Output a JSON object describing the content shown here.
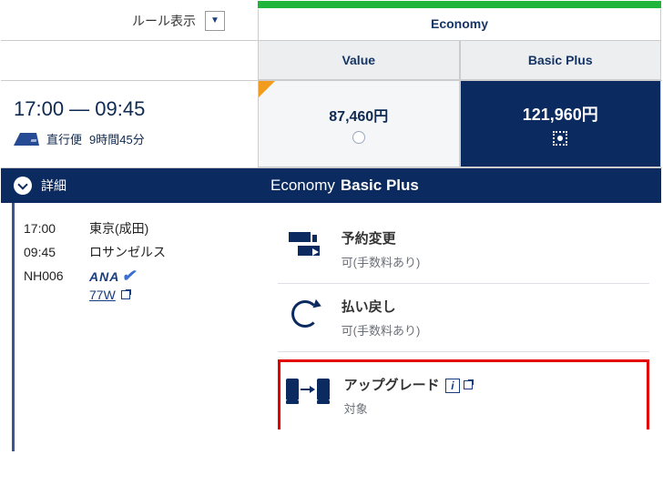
{
  "header": {
    "rules_label": "ルール表示",
    "class_group": "Economy",
    "fare_classes": {
      "value": "Value",
      "basic_plus": "Basic Plus"
    }
  },
  "flight": {
    "dep_time": "17:00",
    "arr_time": "09:45",
    "time_display": "17:00 — 09:45",
    "type_label": "直行便",
    "duration": "9時間45分",
    "segments": [
      {
        "time": "17:00",
        "place": "東京(成田)"
      },
      {
        "time": "09:45",
        "place": "ロサンゼルス"
      }
    ],
    "flight_number": "NH006",
    "operator": "ANA",
    "aircraft": "77W"
  },
  "prices": {
    "value": "87,460円",
    "basic_plus": "121,960円"
  },
  "expand": {
    "left_label": "詳細",
    "right_class_group": "Economy",
    "right_fare_class": "Basic Plus"
  },
  "benefits": {
    "change_title": "予約変更",
    "change_detail": "可(手数料あり)",
    "refund_title": "払い戻し",
    "refund_detail": "可(手数料あり)",
    "upgrade_title": "アップグレード",
    "upgrade_detail": "対象"
  }
}
